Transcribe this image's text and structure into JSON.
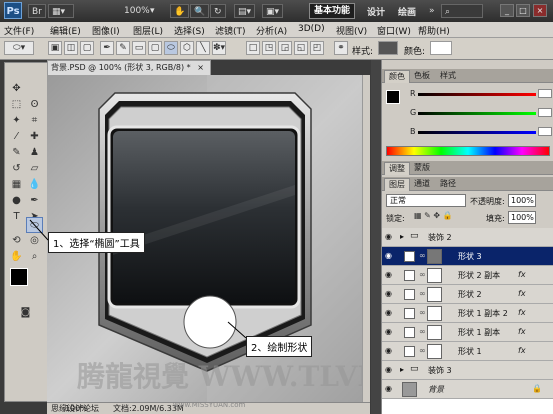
{
  "app": {
    "logo": "Ps"
  },
  "topbar": {
    "zoom_value": "100%",
    "workspaces": [
      "基本功能",
      "设计",
      "绘画"
    ],
    "window_buttons": [
      "_",
      "□",
      "×"
    ]
  },
  "menu": [
    "文件(F)",
    "编辑(E)",
    "图像(I)",
    "图层(L)",
    "选择(S)",
    "滤镜(T)",
    "分析(A)",
    "3D(D)",
    "视图(V)",
    "窗口(W)",
    "帮助(H)"
  ],
  "options": {
    "style_label": "样式:",
    "color_label": "颜色:"
  },
  "document": {
    "tab_title": "背景.PSD @ 100% (形状 3, RGB/8) *",
    "zoom": "100%",
    "status": "文档:2.09M/6.33M"
  },
  "color_panel": {
    "tabs": [
      "颜色",
      "色板",
      "样式"
    ],
    "channels": [
      {
        "label": "R",
        "value": ""
      },
      {
        "label": "G",
        "value": ""
      },
      {
        "label": "B",
        "value": ""
      }
    ]
  },
  "adjust_panel": {
    "tabs": [
      "调整",
      "蒙版"
    ]
  },
  "layers_panel": {
    "tabs": [
      "图层",
      "通道",
      "路径"
    ],
    "blend_mode": "正常",
    "opacity_label": "不透明度:",
    "opacity": "100%",
    "lock_label": "锁定:",
    "fill_label": "填充:",
    "fill": "100%",
    "layers": [
      {
        "name": "装饰 2",
        "type": "group",
        "selected": false,
        "fx": ""
      },
      {
        "name": "形状 3",
        "type": "shape",
        "selected": true,
        "fx": ""
      },
      {
        "name": "形状 2 副本",
        "type": "shape",
        "selected": false,
        "fx": "fx"
      },
      {
        "name": "形状 2",
        "type": "shape",
        "selected": false,
        "fx": "fx"
      },
      {
        "name": "形状 1 副本 2",
        "type": "shape",
        "selected": false,
        "fx": "fx"
      },
      {
        "name": "形状 1 副本",
        "type": "shape",
        "selected": false,
        "fx": "fx"
      },
      {
        "name": "形状 1",
        "type": "shape",
        "selected": false,
        "fx": "fx"
      },
      {
        "name": "装饰 3",
        "type": "group",
        "selected": false,
        "fx": ""
      },
      {
        "name": "背景",
        "type": "background",
        "selected": false,
        "fx": ""
      }
    ]
  },
  "annotations": {
    "step1": "1、选择“椭圆”工具",
    "step2": "2、绘制形状"
  },
  "watermark": {
    "text": "腾龍視覺 WWW.TLVI.NET",
    "forum": "思缘设计论坛",
    "forum_url": "www.MISSYUAN.com"
  },
  "colors": {
    "selection": "#0a246a",
    "workspace_active": "#1e1e1e"
  }
}
